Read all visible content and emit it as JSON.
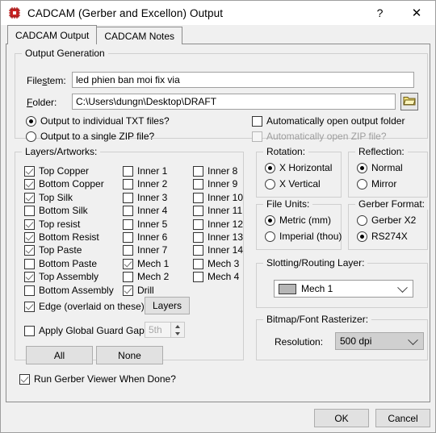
{
  "window": {
    "title": "CADCAM (Gerber and Excellon) Output",
    "icon": "chip-icon",
    "help_label": "?",
    "close_label": "✕",
    "accent": "#cc2222",
    "bg": "#f0f0f0"
  },
  "tabs": [
    {
      "label": "CADCAM Output",
      "active": true
    },
    {
      "label": "CADCAM Notes",
      "active": false
    }
  ],
  "output_generation": {
    "legend": "Output Generation",
    "filestem_label": "Filestem:",
    "filestem_value": "led phien ban moi fix via",
    "folder_label": "Folder:",
    "folder_value": "C:\\Users\\dungn\\Desktop\\DRAFT",
    "browse_icon": "folder-open-icon",
    "radio_individual": "Output to individual TXT files?",
    "radio_zip": "Output to a single ZIP file?",
    "radio_selected": "individual",
    "check_open_folder": {
      "label": "Automatically open output folder",
      "checked": false,
      "disabled": false
    },
    "check_open_zip": {
      "label": "Automatically open ZIP file?",
      "checked": false,
      "disabled": true
    }
  },
  "layers": {
    "legend": "Layers/Artworks:",
    "col1": [
      {
        "label": "Top Copper",
        "checked": true
      },
      {
        "label": "Bottom Copper",
        "checked": true
      },
      {
        "label": "Top Silk",
        "checked": true
      },
      {
        "label": "Bottom Silk",
        "checked": false
      },
      {
        "label": "Top resist",
        "checked": true
      },
      {
        "label": "Bottom Resist",
        "checked": true
      },
      {
        "label": "Top Paste",
        "checked": true
      },
      {
        "label": "Bottom Paste",
        "checked": false
      },
      {
        "label": "Top Assembly",
        "checked": true
      },
      {
        "label": "Bottom Assembly",
        "checked": false
      }
    ],
    "col2": [
      {
        "label": "Inner 1",
        "checked": false
      },
      {
        "label": "Inner 2",
        "checked": false
      },
      {
        "label": "Inner 3",
        "checked": false
      },
      {
        "label": "Inner 4",
        "checked": false
      },
      {
        "label": "Inner 5",
        "checked": false
      },
      {
        "label": "Inner 6",
        "checked": false
      },
      {
        "label": "Inner 7",
        "checked": false
      },
      {
        "label": "Mech 1",
        "checked": true
      },
      {
        "label": "Mech 2",
        "checked": false
      },
      {
        "label": "Drill",
        "checked": true
      }
    ],
    "col3": [
      {
        "label": "Inner 8",
        "checked": false
      },
      {
        "label": "Inner 9",
        "checked": false
      },
      {
        "label": "Inner 10",
        "checked": false
      },
      {
        "label": "Inner 11",
        "checked": false
      },
      {
        "label": "Inner 12",
        "checked": false
      },
      {
        "label": "Inner 13",
        "checked": false
      },
      {
        "label": "Inner 14",
        "checked": false
      },
      {
        "label": "Mech 3",
        "checked": false
      },
      {
        "label": "Mech 4",
        "checked": false
      }
    ],
    "edge": {
      "label": "Edge (overlaid on these)",
      "checked": true
    },
    "layers_button": "Layers",
    "guard_gap": {
      "label": "Apply Global Guard Gap",
      "checked": false
    },
    "guard_gap_value": "5th",
    "all_button": "All",
    "none_button": "None"
  },
  "rotation": {
    "legend": "Rotation:",
    "options": [
      "X Horizontal",
      "X Vertical"
    ],
    "selected": "X Horizontal"
  },
  "reflection": {
    "legend": "Reflection:",
    "options": [
      "Normal",
      "Mirror"
    ],
    "selected": "Normal"
  },
  "file_units": {
    "legend": "File Units:",
    "options": [
      "Metric (mm)",
      "Imperial (thou)"
    ],
    "selected": "Metric (mm)"
  },
  "gerber_format": {
    "legend": "Gerber Format:",
    "options": [
      "Gerber X2",
      "RS274X"
    ],
    "selected": "RS274X"
  },
  "slotting": {
    "legend": "Slotting/Routing Layer:",
    "value": "Mech 1",
    "swatch_color": "#b6b6b6"
  },
  "rasterizer": {
    "legend": "Bitmap/Font Rasterizer:",
    "resolution_label": "Resolution:",
    "resolution_value": "500 dpi"
  },
  "bottom": {
    "run_viewer": {
      "label": "Run Gerber Viewer When Done?",
      "checked": true
    }
  },
  "footer": {
    "ok_label": "OK",
    "cancel_label": "Cancel"
  }
}
